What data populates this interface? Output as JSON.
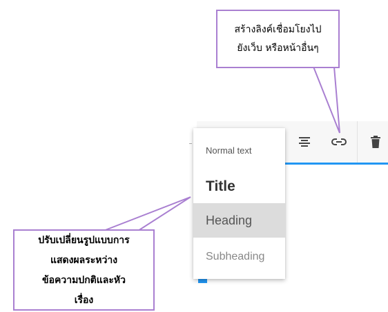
{
  "toolbar": {
    "buttons": [
      {
        "name": "align-center",
        "icon": "align-center-icon"
      },
      {
        "name": "insert-link",
        "icon": "link-icon"
      },
      {
        "name": "delete",
        "icon": "trash-icon"
      }
    ],
    "accent_color": "#2196f3"
  },
  "text_style_menu": {
    "items": [
      {
        "label": "Normal text"
      },
      {
        "label": "Title"
      },
      {
        "label": "Heading",
        "highlighted": true
      },
      {
        "label": "Subheading"
      }
    ]
  },
  "callouts": {
    "link": {
      "line1": "สร้างลิงค์เชื่อมโยงไป",
      "line2": "ยังเว็บ หรือหน้าอื่นๆ"
    },
    "text_style": {
      "line1": "ปรับเปลี่ยนรูปแบบการ",
      "line2": "แสดงผลระหว่าง",
      "line3": "ข้อความปกติและหัว",
      "line4": "เรื่อง"
    },
    "border_color": "#a97fd1"
  }
}
